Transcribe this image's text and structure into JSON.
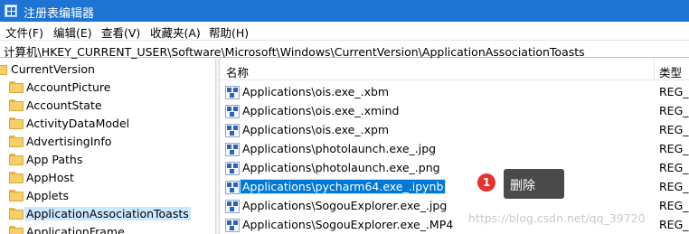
{
  "window": {
    "title": "注册表编辑器"
  },
  "menu": [
    "文件(F)",
    "编辑(E)",
    "查看(V)",
    "收藏夹(A)",
    "帮助(H)"
  ],
  "address": "计算机\\HKEY_CURRENT_USER\\Software\\Microsoft\\Windows\\CurrentVersion\\ApplicationAssociationToasts",
  "tree": {
    "parent": "CurrentVersion",
    "items": [
      "AccountPicture",
      "AccountState",
      "ActivityDataModel",
      "AdvertisingInfo",
      "App Paths",
      "AppHost",
      "Applets",
      "ApplicationAssociationToasts",
      "ApplicationFrame"
    ],
    "selected": "ApplicationAssociationToasts"
  },
  "list": {
    "columns": {
      "name": "名称",
      "type": "类型"
    },
    "rows": [
      {
        "name": "Applications\\ois.exe_.xbm",
        "type": "REG_"
      },
      {
        "name": "Applications\\ois.exe_.xmind",
        "type": "REG_"
      },
      {
        "name": "Applications\\ois.exe_.xpm",
        "type": "REG_"
      },
      {
        "name": "Applications\\photolaunch.exe_.jpg",
        "type": "REG_"
      },
      {
        "name": "Applications\\photolaunch.exe_.png",
        "type": "REG_"
      },
      {
        "name": "Applications\\pycharm64.exe_.ipynb",
        "type": "REG_"
      },
      {
        "name": "Applications\\SogouExplorer.exe_.jpg",
        "type": "REG_"
      },
      {
        "name": "Applications\\SogouExplorer.exe_.MP4",
        "type": "REG_"
      }
    ],
    "selected": "Applications\\pycharm64.exe_.ipynb"
  },
  "annotation": {
    "badge": "1",
    "tooltip": "删除"
  },
  "watermark": "https://blog.csdn.net/qq_39720"
}
